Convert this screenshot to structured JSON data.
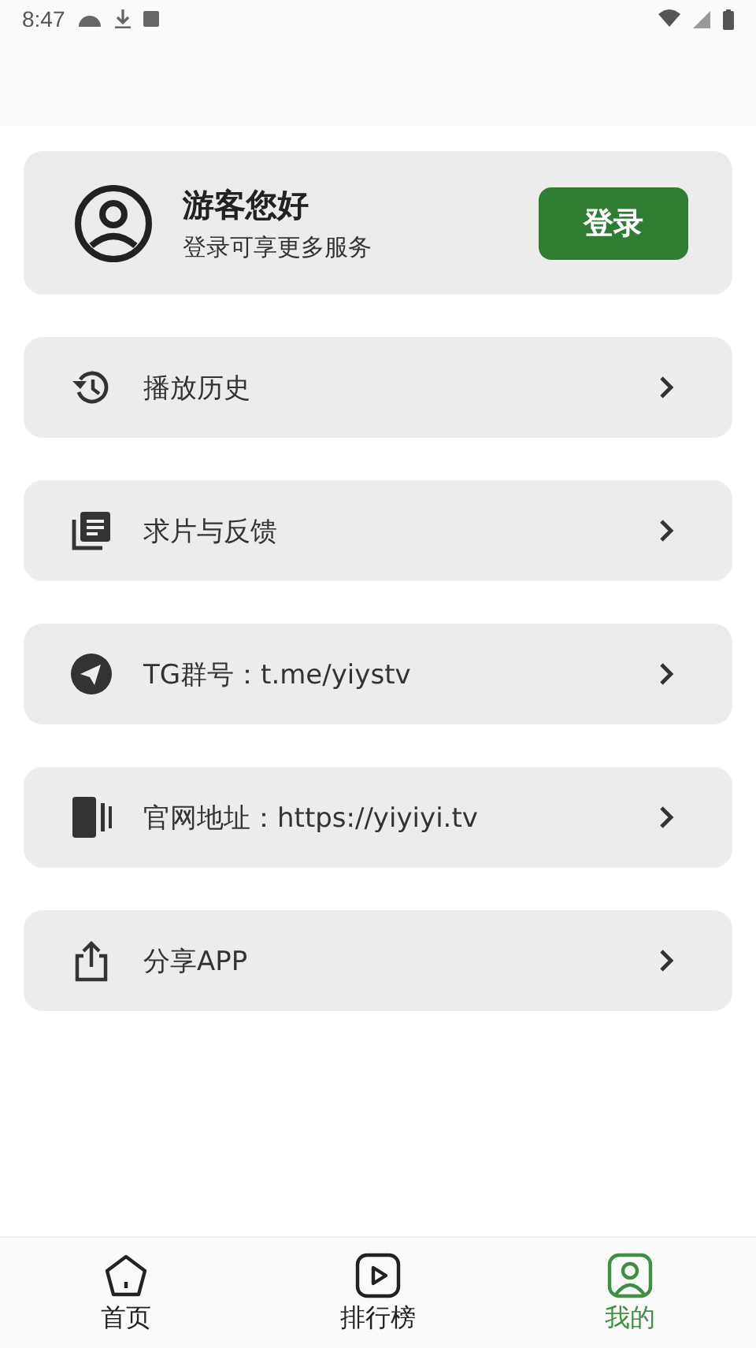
{
  "status_bar": {
    "time": "8:47"
  },
  "user_card": {
    "greeting": "游客您好",
    "subtitle": "登录可享更多服务",
    "login_button": "登录"
  },
  "menu": [
    {
      "kind": "history",
      "label": "播放历史"
    },
    {
      "kind": "list",
      "label": "求片与反馈"
    },
    {
      "kind": "telegram",
      "label": "TG群号：t.me/yiystv"
    },
    {
      "kind": "site",
      "label": "官网地址：https://yiyiyi.tv"
    },
    {
      "kind": "share",
      "label": "分享APP"
    }
  ],
  "bottom_nav": [
    {
      "kind": "home",
      "label": "首页",
      "selected": false
    },
    {
      "kind": "play",
      "label": "排行榜",
      "selected": false
    },
    {
      "kind": "profile",
      "label": "我的",
      "selected": true
    }
  ]
}
